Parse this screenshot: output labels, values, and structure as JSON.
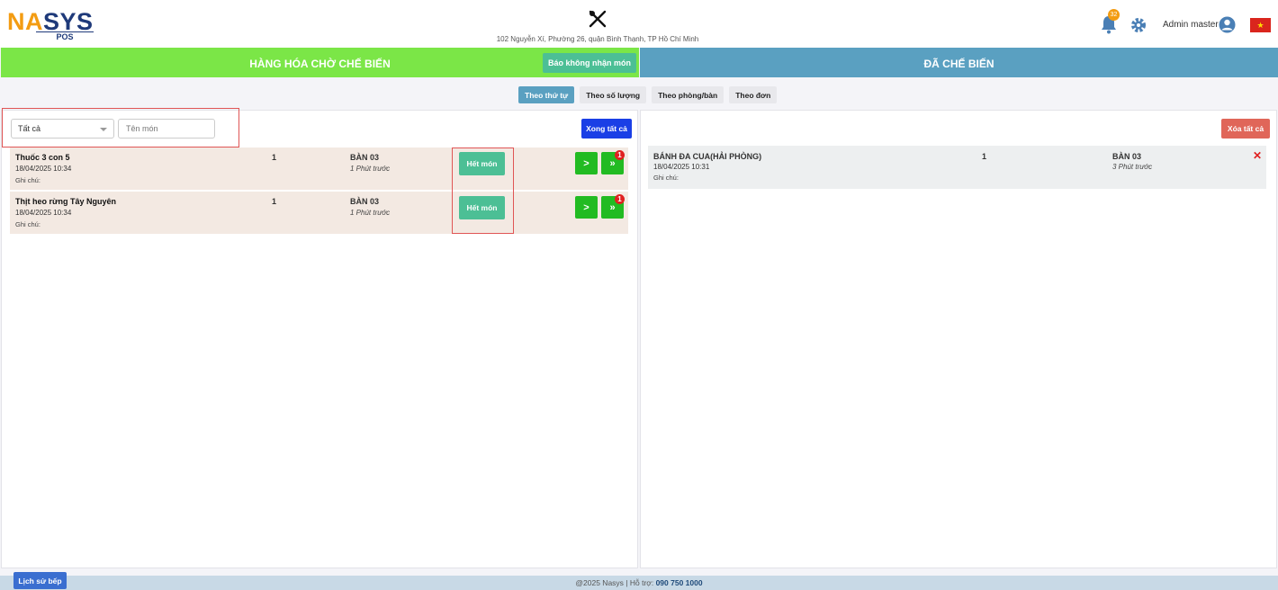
{
  "header": {
    "logo_part1": "NA",
    "logo_part2": "S",
    "logo_part3": "YS",
    "logo_sub": "POS",
    "address": "102 Nguyễn Xí, Phường 26, quận Bình Thạnh, TP Hồ Chí Minh",
    "notification_count": "32",
    "user_name": "Admin master",
    "flag_icon": "vietnam-flag",
    "flag_star": "★"
  },
  "left_panel": {
    "title": "HÀNG HÓA CHỜ CHẾ BIẾN",
    "report_button": "Báo không nhận món",
    "filter_value": "Tất cả",
    "search_placeholder": "Tên món",
    "all_done_button": "Xong tất cả",
    "rows": [
      {
        "name": "Thuốc 3 con 5",
        "time": "18/04/2025 10:34",
        "note": "Ghi chú:",
        "qty": "1",
        "table": "BÀN 03",
        "ago": "1 Phút trước",
        "out_button": "Hết món",
        "next_button": ">",
        "fast_button": "»",
        "fast_badge": "1"
      },
      {
        "name": "Thịt heo rừng Tây Nguyên",
        "time": "18/04/2025 10:34",
        "note": "Ghi chú:",
        "qty": "1",
        "table": "BÀN 03",
        "ago": "1 Phút trước",
        "out_button": "Hết món",
        "next_button": ">",
        "fast_button": "»",
        "fast_badge": "1"
      }
    ]
  },
  "tabs": [
    {
      "label": "Theo thứ tự",
      "active": true
    },
    {
      "label": "Theo số lượng",
      "active": false
    },
    {
      "label": "Theo phòng/bàn",
      "active": false
    },
    {
      "label": "Theo đơn",
      "active": false
    }
  ],
  "right_panel": {
    "title": "ĐÃ CHẾ BIẾN",
    "clear_all_button": "Xóa tất cả",
    "rows": [
      {
        "name": "BÁNH ĐA CUA(HẢI PHÒNG)",
        "time": "18/04/2025 10:31",
        "note": "Ghi chú:",
        "qty": "1",
        "table": "BÀN 03",
        "ago": "3 Phút trước",
        "delete_icon": "✕"
      }
    ]
  },
  "footer": {
    "history_button": "Lịch sử bếp",
    "copyright": "@2025 Nasys | Hỗ trợ: ",
    "phone": "090 750 1000"
  },
  "colors": {
    "left_banner": "#7be647",
    "right_banner": "#5aa0c1",
    "accent_green": "#4cbf95",
    "done_blue": "#1a3fe6",
    "clear_red": "#e06659"
  }
}
